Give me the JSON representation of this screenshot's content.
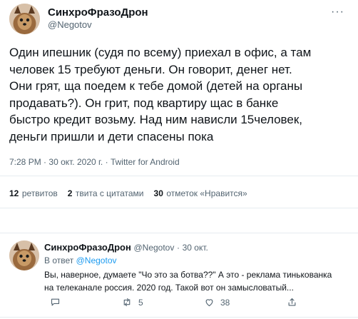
{
  "tweet": {
    "author_name": "СинхроФразоДрон",
    "author_handle": "@Negotov",
    "more_glyph": "···",
    "text": "Один ипешник (судя по всему) приехал в офис, а там\nчеловек 15 требуют деньги. Он говорит, денег нет.\nОни грят, ща поедем к тебе домой (детей на органы\nпродавать?). Он грит, под квартиру щас в банке\nбыстро кредит возьму. Над ним нависли 15человек,\nденьги пришли и дети спасены пока",
    "time": "7:28 PM",
    "dot1": "·",
    "date": "30 окт. 2020 г.",
    "dot2": "·",
    "source": "Twitter for Android"
  },
  "stats": {
    "retweets_count": "12",
    "retweets_label": "ретвитов",
    "quotes_count": "2",
    "quotes_label": "твита с цитатами",
    "likes_count": "30",
    "likes_label": "отметок «Нравится»"
  },
  "reply": {
    "author_name": "СинхроФразоДрон",
    "author_handle": "@Negotov",
    "dot": "·",
    "date": "30 окт.",
    "reply_to_label": "В ответ",
    "reply_to_handle": "@Negotov",
    "text": "Вы, наверное, думаете \"Чо это за ботва??\" А это - реклама тинькованка\nна телеканале россия. 2020 год. Такой вот он замысловатый...",
    "retweets": "5",
    "likes": "38"
  },
  "colors": {
    "accent": "#1d9bf0",
    "muted": "#536471",
    "divider": "#e6ecf0"
  },
  "icons": {
    "avatar": "yorkshire-terrier-photo",
    "reply": "comment-icon",
    "retweet": "retweet-icon",
    "like": "heart-icon",
    "share": "share-icon"
  }
}
